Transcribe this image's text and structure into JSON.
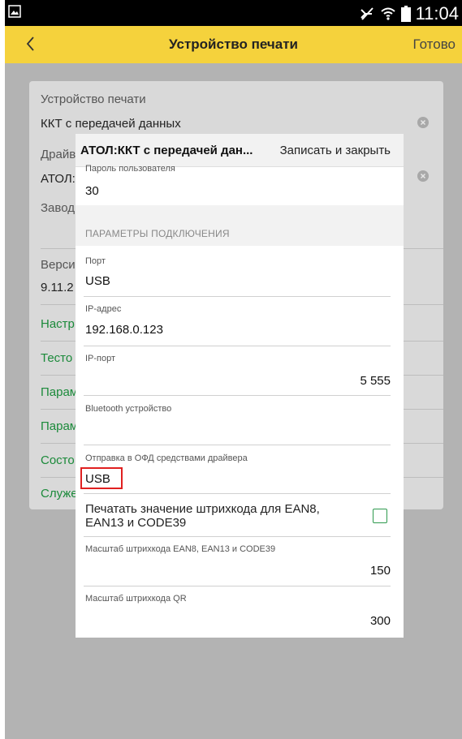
{
  "status_bar": {
    "time": "11:04"
  },
  "header": {
    "title": "Устройство печати",
    "done_label": "Готово"
  },
  "background_form": {
    "device_label": "Устройство печати",
    "device_value": "ККТ с передачей данных",
    "driver_label": "Драйв",
    "driver_value": "АТОЛ:",
    "serial_label": "Завод",
    "version_label": "Верси",
    "version_value": "9.11.2",
    "links": [
      "Настр",
      "Тесто",
      "Парам",
      "Парам",
      "Состо",
      "Служе"
    ]
  },
  "dialog": {
    "title": "АТОЛ:ККТ с передачей дан...",
    "action_label": "Записать и закрыть",
    "password": {
      "label": "Пароль пользователя",
      "value": "30"
    },
    "section_title": "ПАРАМЕТРЫ ПОДКЛЮЧЕНИЯ",
    "port": {
      "label": "Порт",
      "value": "USB"
    },
    "ip_address": {
      "label": "IP-адрес",
      "value": "192.168.0.123"
    },
    "ip_port": {
      "label": "IP-порт",
      "value": "5 555"
    },
    "bluetooth": {
      "label": "Bluetooth устройство",
      "value": ""
    },
    "ofd": {
      "label": "Отправка в ОФД средствами драйвера",
      "value": "USB"
    },
    "print_barcode": {
      "label": "Печатать значение штрихкода для EAN8, EAN13 и CODE39",
      "checked": false
    },
    "barcode_scale": {
      "label": "Масштаб штрихкода EAN8, EAN13 и CODE39",
      "value": "150"
    },
    "qr_scale": {
      "label": "Масштаб штрихкода QR",
      "value": "300"
    }
  },
  "colors": {
    "header": "#f5d23c",
    "link": "#1b8a3a",
    "checkbox": "#2e9a4e",
    "highlight": "#e02020"
  }
}
